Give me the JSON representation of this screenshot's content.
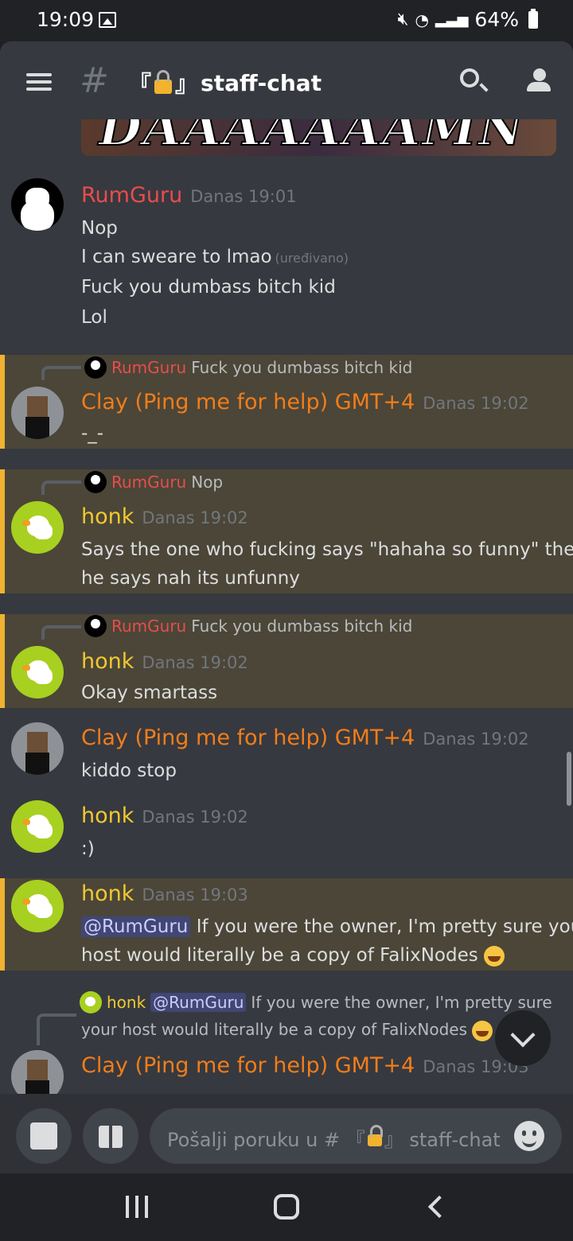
{
  "status": {
    "time": "19:09",
    "battery": "64%"
  },
  "header": {
    "channel": "staff-chat",
    "bracket_open": "『",
    "bracket_close": "』"
  },
  "embed": {
    "image_text": "DAAAAAAAMN"
  },
  "messages": [
    {
      "author": "RumGuru",
      "time": "Danas 19:01",
      "lines": [
        "Nop",
        "I can sweare to lmao",
        "Fuck you dumbass bitch kid",
        "Lol"
      ],
      "edited": "(uređivano)"
    },
    {
      "reply_author": "RumGuru",
      "reply_text": "Fuck you dumbass bitch kid",
      "author": "Clay (Ping me for help) GMT+4",
      "time": "Danas 19:02",
      "lines": [
        "-_-"
      ]
    },
    {
      "reply_author": "RumGuru",
      "reply_text": "Nop",
      "author": "honk",
      "time": "Danas 19:02",
      "lines": [
        "Says the one who fucking says \"hahaha so funny\" then",
        "he says nah its unfunny"
      ]
    },
    {
      "reply_author": "RumGuru",
      "reply_text": "Fuck you dumbass bitch kid",
      "author": "honk",
      "time": "Danas 19:02",
      "lines": [
        "Okay smartass"
      ]
    },
    {
      "author": "Clay (Ping me for help) GMT+4",
      "time": "Danas 19:02",
      "lines": [
        "kiddo stop"
      ]
    },
    {
      "author": "honk",
      "time": "Danas 19:02",
      "lines": [
        ":)"
      ]
    },
    {
      "author": "honk",
      "time": "Danas 19:03",
      "mention": "@RumGuru",
      "lines": [
        "If you were the owner, I'm pretty sure your",
        "host would literally be a copy of FalixNodes"
      ]
    },
    {
      "reply_author": "honk",
      "reply_mention": "@RumGuru",
      "reply_text": "If you were the owner, I'm pretty sure",
      "reply_text2": "your host would literally be a copy of FalixNodes",
      "author": "Clay (Ping me for help) GMT+4",
      "time": "Danas 19:03"
    }
  ],
  "composer": {
    "placeholder": "Pošalji poruku u # 『",
    "placeholder_channel": "』 staff-chat"
  },
  "colors": {
    "rumguru": "#e84d4d",
    "clay": "#f27d1a",
    "honk": "#f2c830",
    "highlight": "#f0b232"
  },
  "icons": [
    "hamburger-icon",
    "hash-icon",
    "lock-icon",
    "search-icon",
    "members-icon",
    "image-icon",
    "gift-icon",
    "emoji-icon",
    "chevron-down-icon"
  ]
}
